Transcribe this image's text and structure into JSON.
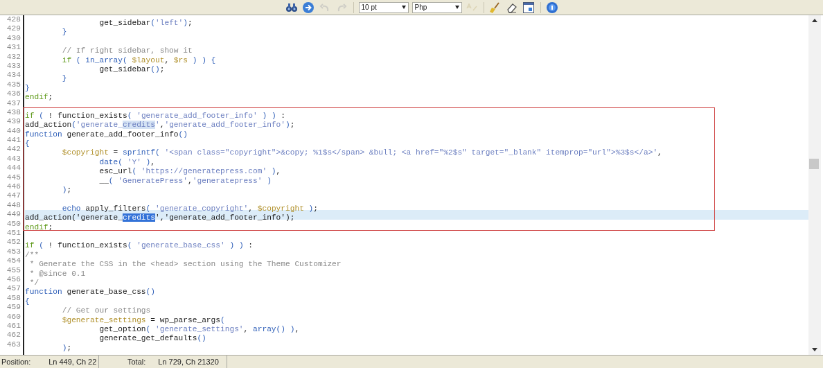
{
  "toolbar": {
    "tools": [
      {
        "kind": "find",
        "disabled": false
      },
      {
        "kind": "goto",
        "disabled": false
      },
      {
        "kind": "undo",
        "disabled": true
      },
      {
        "kind": "redo",
        "disabled": true
      }
    ],
    "font_size": "10 pt",
    "language": "Php",
    "tools_after": [
      {
        "kind": "spellcheck",
        "disabled": true
      },
      {
        "kind": "clean",
        "disabled": false
      },
      {
        "kind": "erase",
        "disabled": false
      },
      {
        "kind": "window",
        "disabled": false
      },
      {
        "kind": "help",
        "disabled": false
      }
    ]
  },
  "editor": {
    "lines": [
      {
        "number": "428",
        "current": false,
        "tokens": [
          {
            "kind": "plain",
            "text": "                get_sidebar"
          },
          {
            "kind": "punct",
            "text": "("
          },
          {
            "kind": "string",
            "text": "'left'"
          },
          {
            "kind": "punct",
            "text": ")"
          },
          {
            "kind": "plain",
            "text": ";"
          }
        ]
      },
      {
        "number": "429",
        "current": false,
        "tokens": [
          {
            "kind": "punct",
            "text": "        }"
          }
        ]
      },
      {
        "number": "430",
        "current": false
      },
      {
        "number": "431",
        "current": false,
        "tokens": [
          {
            "kind": "comment",
            "text": "        // If right sidebar, show it"
          }
        ]
      },
      {
        "number": "432",
        "current": false,
        "tokens": [
          {
            "kind": "control",
            "text": "        if"
          },
          {
            "kind": "punct",
            "text": " ( in_array( "
          },
          {
            "kind": "variable",
            "text": "$layout"
          },
          {
            "kind": "plain",
            "text": ", "
          },
          {
            "kind": "variable",
            "text": "$rs"
          },
          {
            "kind": "punct",
            "text": " ) ) {"
          }
        ]
      },
      {
        "number": "433",
        "current": false,
        "tokens": [
          {
            "kind": "plain",
            "text": "                get_sidebar"
          },
          {
            "kind": "punct",
            "text": "()"
          },
          {
            "kind": "plain",
            "text": ";"
          }
        ]
      },
      {
        "number": "434",
        "current": false,
        "tokens": [
          {
            "kind": "punct",
            "text": "        }"
          }
        ]
      },
      {
        "number": "435",
        "current": false,
        "tokens": [
          {
            "kind": "punct",
            "text": "}"
          }
        ]
      },
      {
        "number": "436",
        "current": false,
        "tokens": [
          {
            "kind": "control",
            "text": "endif"
          },
          {
            "kind": "plain",
            "text": ";"
          }
        ]
      },
      {
        "number": "437",
        "current": false
      },
      {
        "number": "438",
        "current": false,
        "tokens": [
          {
            "kind": "control",
            "text": "if"
          },
          {
            "kind": "punct",
            "text": " ( "
          },
          {
            "kind": "plain",
            "text": "! function_exists"
          },
          {
            "kind": "punct",
            "text": "( "
          },
          {
            "kind": "string",
            "text": "'generate_add_footer_info'"
          },
          {
            "kind": "punct",
            "text": " ) ) "
          },
          {
            "kind": "plain",
            "text": ":"
          }
        ]
      },
      {
        "number": "439",
        "current": false,
        "tokens": [
          {
            "kind": "plain",
            "text": "add_action"
          },
          {
            "kind": "punct",
            "text": "("
          },
          {
            "kind": "string",
            "text": "'generate_"
          },
          {
            "kind": "match",
            "text": "credits"
          },
          {
            "kind": "string",
            "text": "'"
          },
          {
            "kind": "plain",
            "text": ","
          },
          {
            "kind": "string",
            "text": "'generate_add_footer_info'"
          },
          {
            "kind": "punct",
            "text": ")"
          },
          {
            "kind": "plain",
            "text": ";"
          }
        ]
      },
      {
        "number": "440",
        "current": false,
        "tokens": [
          {
            "kind": "punct",
            "text": "function"
          },
          {
            "kind": "plain",
            "text": " generate_add_footer_info"
          },
          {
            "kind": "punct",
            "text": "()"
          }
        ]
      },
      {
        "number": "441",
        "current": false,
        "tokens": [
          {
            "kind": "punct",
            "text": "{"
          }
        ]
      },
      {
        "number": "442",
        "current": false,
        "tokens": [
          {
            "kind": "variable",
            "text": "        $copyright"
          },
          {
            "kind": "plain",
            "text": " = "
          },
          {
            "kind": "punct",
            "text": "sprintf( "
          },
          {
            "kind": "string",
            "text": "'<span class=\"copyright\">&copy; %1$s</span> &bull; <a href=\"%2$s\" target=\"_blank\" itemprop=\"url\">%3$s</a>'"
          },
          {
            "kind": "plain",
            "text": ","
          }
        ]
      },
      {
        "number": "443",
        "current": false,
        "tokens": [
          {
            "kind": "punct",
            "text": "                date( "
          },
          {
            "kind": "string",
            "text": "'Y'"
          },
          {
            "kind": "punct",
            "text": " )"
          },
          {
            "kind": "plain",
            "text": ","
          }
        ]
      },
      {
        "number": "444",
        "current": false,
        "tokens": [
          {
            "kind": "plain",
            "text": "                esc_url"
          },
          {
            "kind": "punct",
            "text": "( "
          },
          {
            "kind": "string",
            "text": "'https://generatepress.com'"
          },
          {
            "kind": "punct",
            "text": " )"
          },
          {
            "kind": "plain",
            "text": ","
          }
        ]
      },
      {
        "number": "445",
        "current": false,
        "tokens": [
          {
            "kind": "plain",
            "text": "                __"
          },
          {
            "kind": "punct",
            "text": "( "
          },
          {
            "kind": "string",
            "text": "'GeneratePress'"
          },
          {
            "kind": "plain",
            "text": ","
          },
          {
            "kind": "string",
            "text": "'generatepress'"
          },
          {
            "kind": "punct",
            "text": " )"
          }
        ]
      },
      {
        "number": "446",
        "current": false,
        "tokens": [
          {
            "kind": "punct",
            "text": "        )"
          },
          {
            "kind": "plain",
            "text": ";"
          }
        ]
      },
      {
        "number": "447",
        "current": false
      },
      {
        "number": "448",
        "current": false,
        "tokens": [
          {
            "kind": "punct",
            "text": "        echo"
          },
          {
            "kind": "plain",
            "text": " apply_filters"
          },
          {
            "kind": "punct",
            "text": "( "
          },
          {
            "kind": "string",
            "text": "'generate_copyright'"
          },
          {
            "kind": "plain",
            "text": ", "
          },
          {
            "kind": "variable",
            "text": "$copyright"
          },
          {
            "kind": "punct",
            "text": " )"
          },
          {
            "kind": "plain",
            "text": ";"
          }
        ]
      },
      {
        "number": "449",
        "current": true,
        "tokens": [
          {
            "kind": "plain",
            "text": "add_action('generate_"
          },
          {
            "kind": "selection",
            "text": "credits"
          },
          {
            "kind": "plain",
            "text": "','generate_add_footer_info');"
          }
        ]
      },
      {
        "number": "450",
        "current": false,
        "tokens": [
          {
            "kind": "control",
            "text": "endif"
          },
          {
            "kind": "plain",
            "text": ";"
          }
        ]
      },
      {
        "number": "451",
        "current": false
      },
      {
        "number": "452",
        "current": false,
        "tokens": [
          {
            "kind": "control",
            "text": "if"
          },
          {
            "kind": "punct",
            "text": " ( "
          },
          {
            "kind": "plain",
            "text": "! function_exists"
          },
          {
            "kind": "punct",
            "text": "( "
          },
          {
            "kind": "string",
            "text": "'generate_base_css'"
          },
          {
            "kind": "punct",
            "text": " ) ) "
          },
          {
            "kind": "plain",
            "text": ":"
          }
        ]
      },
      {
        "number": "453",
        "current": false,
        "tokens": [
          {
            "kind": "comment",
            "text": "/**"
          }
        ]
      },
      {
        "number": "454",
        "current": false,
        "tokens": [
          {
            "kind": "comment",
            "text": " * Generate the CSS in the <head> section using the Theme Customizer"
          }
        ]
      },
      {
        "number": "455",
        "current": false,
        "tokens": [
          {
            "kind": "comment",
            "text": " * @since 0.1"
          }
        ]
      },
      {
        "number": "456",
        "current": false,
        "tokens": [
          {
            "kind": "comment",
            "text": " */"
          }
        ]
      },
      {
        "number": "457",
        "current": false,
        "tokens": [
          {
            "kind": "punct",
            "text": "function"
          },
          {
            "kind": "plain",
            "text": " generate_base_css"
          },
          {
            "kind": "punct",
            "text": "()"
          }
        ]
      },
      {
        "number": "458",
        "current": false,
        "tokens": [
          {
            "kind": "punct",
            "text": "{"
          }
        ]
      },
      {
        "number": "459",
        "current": false,
        "tokens": [
          {
            "kind": "comment",
            "text": "        // Get our settings"
          }
        ]
      },
      {
        "number": "460",
        "current": false,
        "tokens": [
          {
            "kind": "variable",
            "text": "        $generate_settings"
          },
          {
            "kind": "plain",
            "text": " = wp_parse_args"
          },
          {
            "kind": "punct",
            "text": "("
          }
        ]
      },
      {
        "number": "461",
        "current": false,
        "tokens": [
          {
            "kind": "plain",
            "text": "                get_option"
          },
          {
            "kind": "punct",
            "text": "( "
          },
          {
            "kind": "string",
            "text": "'generate_settings'"
          },
          {
            "kind": "plain",
            "text": ", "
          },
          {
            "kind": "punct",
            "text": "array() )"
          },
          {
            "kind": "plain",
            "text": ","
          }
        ]
      },
      {
        "number": "462",
        "current": false,
        "tokens": [
          {
            "kind": "plain",
            "text": "                generate_get_defaults"
          },
          {
            "kind": "punct",
            "text": "()"
          }
        ]
      },
      {
        "number": "463",
        "current": false,
        "tokens": [
          {
            "kind": "punct",
            "text": "        )"
          },
          {
            "kind": "plain",
            "text": ";"
          }
        ]
      }
    ]
  },
  "status_bar": {
    "position_label": "Position:",
    "position": "Ln 449, Ch 22",
    "total_label": "Total:",
    "total": "Ln 729, Ch 21320"
  }
}
